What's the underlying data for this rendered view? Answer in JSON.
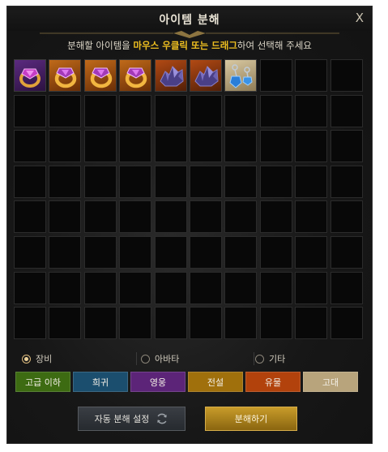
{
  "window": {
    "title": "아이템 분해",
    "close_label": "X"
  },
  "instruction": {
    "part1": "분해할 아이템을 ",
    "highlight": "마우스 우클릭 또는 드래그",
    "part2": "하여 선택해 주세요"
  },
  "inventory": {
    "items": [
      {
        "icon": "purple-gem-ring-icon",
        "color": "#5b2a80"
      },
      {
        "icon": "gold-gem-ring-icon",
        "color": "#c06a1a"
      },
      {
        "icon": "gold-gem-ring-icon",
        "color": "#c06a1a"
      },
      {
        "icon": "gold-gem-ring-icon",
        "color": "#c06a1a"
      },
      {
        "icon": "crystal-ore-icon",
        "color": "#b24a14"
      },
      {
        "icon": "crystal-ore-icon",
        "color": "#b24a14"
      },
      {
        "icon": "blue-gem-earring-icon",
        "color": "#d9c9a2"
      }
    ]
  },
  "filters": [
    {
      "label": "장비",
      "selected": true
    },
    {
      "label": "아바타",
      "selected": false
    },
    {
      "label": "기타",
      "selected": false
    }
  ],
  "grades": [
    {
      "label": "고급 이하",
      "color": "#3d6b12"
    },
    {
      "label": "희귀",
      "color": "#1b4e6e"
    },
    {
      "label": "영웅",
      "color": "#5c2478"
    },
    {
      "label": "전설",
      "color": "#a0700c"
    },
    {
      "label": "유물",
      "color": "#b2420c"
    },
    {
      "label": "고대",
      "color": "#b8a47c"
    }
  ],
  "actions": {
    "auto_label": "자동 분해 설정",
    "disassemble_label": "분해하기"
  }
}
